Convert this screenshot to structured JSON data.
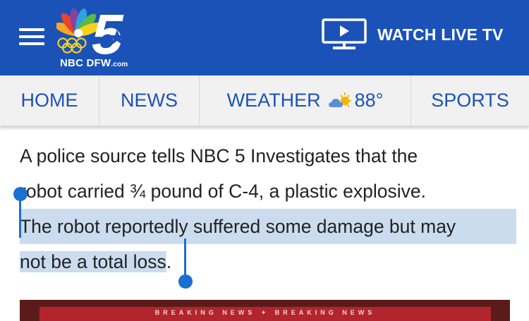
{
  "header": {
    "logo": {
      "text_main": "NBC DFW",
      "text_suffix": ".com",
      "numeral": "5"
    },
    "watch_live_label": "WATCH LIVE TV",
    "colors": {
      "background": "#1b52b8",
      "text": "#ffffff"
    }
  },
  "nav": {
    "items": [
      {
        "label": "HOME"
      },
      {
        "label": "NEWS"
      },
      {
        "label": "WEATHER",
        "temperature": "88°",
        "icon": "partly-sunny-icon"
      },
      {
        "label": "SPORTS"
      }
    ],
    "colors": {
      "background": "#f1f1f1",
      "text": "#1b52b8"
    }
  },
  "article": {
    "line1": "A police source tells NBC 5 Investigates that the",
    "line2_before": "r",
    "line2_after": "obot carried ¾ pound of C-4, a plastic explosive.",
    "line3": "The robot reportedly suffered some damage but may",
    "line4_selected": "not be a total loss",
    "line4_after": ".",
    "selection_color": "#cbdcee",
    "handle_color": "#1a6fd0"
  },
  "card": {
    "banner_text": "BREAKING NEWS  ✦  BREAKING NEWS"
  }
}
